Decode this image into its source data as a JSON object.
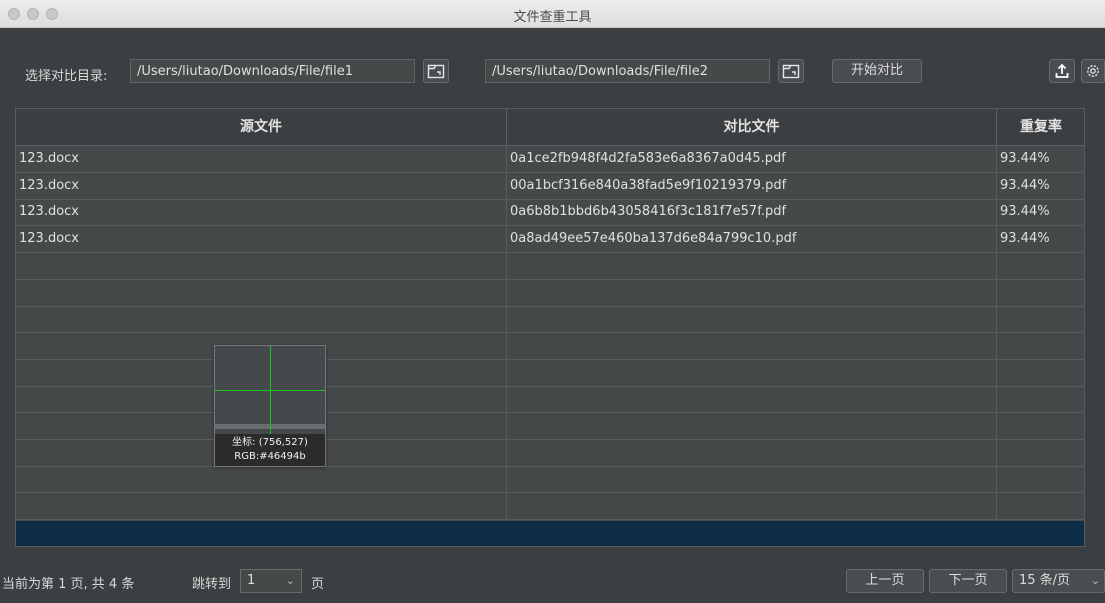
{
  "window": {
    "title": "文件查重工具"
  },
  "toolbar": {
    "dir_label": "选择对比目录:",
    "source_path": "/Users/liutao/Downloads/File/file1",
    "target_path": "/Users/liutao/Downloads/File/file2",
    "start_label": "开始对比",
    "export_icon": "upload-icon",
    "settings_icon": "gear-icon",
    "folder_icon": "folder-open-icon"
  },
  "table": {
    "columns": [
      "源文件",
      "对比文件",
      "重复率"
    ],
    "rows": [
      [
        "123.docx",
        "0a1ce2fb948f4d2fa583e6a8367a0d45.pdf",
        "93.44%"
      ],
      [
        "123.docx",
        "00a1bcf316e840a38fad5e9f10219379.pdf",
        "93.44%"
      ],
      [
        "123.docx",
        "0a6b8b1bbd6b43058416f3c181f7e57f.pdf",
        "93.44%"
      ],
      [
        "123.docx",
        "0a8ad49ee57e460ba137d6e84a799c10.pdf",
        "93.44%"
      ]
    ]
  },
  "magnifier": {
    "coord_text": "坐标: (756,527)",
    "rgb_text": "RGB:#46494b"
  },
  "footer": {
    "page_info": "当前为第 1 页, 共 4 条",
    "jump_label": "跳转到",
    "jump_value": "1",
    "page_suffix": "页",
    "prev_label": "上一页",
    "next_label": "下一页",
    "page_size_label": "15 条/页"
  },
  "colors": {
    "background": "#3c3f41",
    "table_bg": "#45494a",
    "selection": "#0d2c45",
    "crosshair": "#18c418"
  }
}
